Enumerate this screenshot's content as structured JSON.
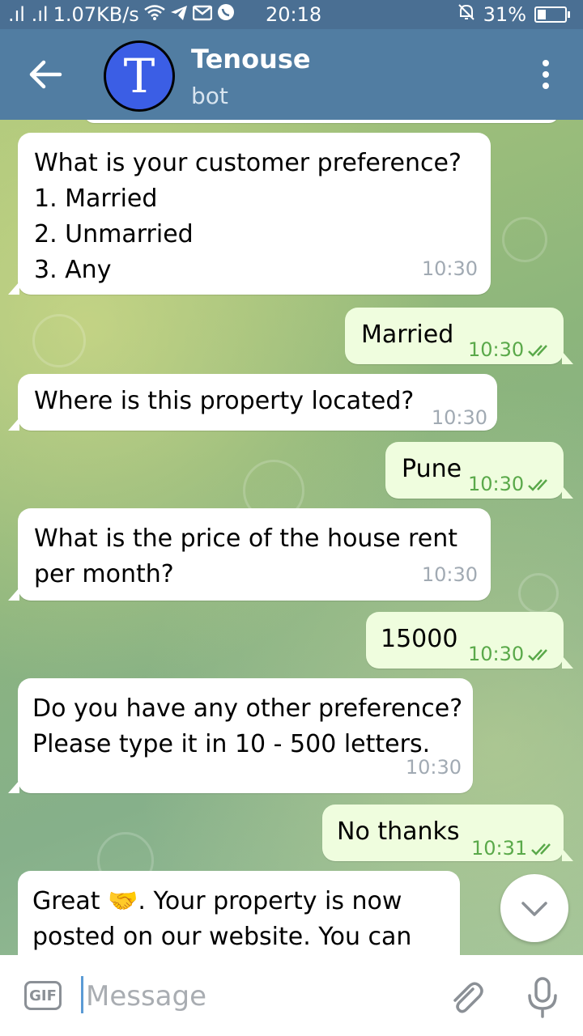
{
  "status_bar": {
    "signal_text": ".ıl .ıl",
    "network_speed": "1.07KB/s",
    "time": "20:18",
    "battery": "31%",
    "battery_level": 0.31
  },
  "header": {
    "avatar_letter": "T",
    "title": "Tenouse",
    "subtitle": "bot"
  },
  "messages": [
    {
      "dir": "in",
      "lines": [
        "What is your customer preference?",
        "1. Married",
        "2. Unmarried",
        "3. Any"
      ],
      "time": "10:30"
    },
    {
      "dir": "out",
      "lines": [
        "Married"
      ],
      "time": "10:30"
    },
    {
      "dir": "in",
      "lines": [
        "Where is this property located?"
      ],
      "time": "10:30"
    },
    {
      "dir": "out",
      "lines": [
        "Pune"
      ],
      "time": "10:30"
    },
    {
      "dir": "in",
      "lines": [
        "What is the price of the house rent",
        "per month?"
      ],
      "time": "10:30"
    },
    {
      "dir": "out",
      "lines": [
        "15000"
      ],
      "time": "10:30"
    },
    {
      "dir": "in",
      "lines": [
        "Do you have any other preference?",
        "Please type it in 10 - 500 letters."
      ],
      "time": "10:30"
    },
    {
      "dir": "out",
      "lines": [
        "No thanks"
      ],
      "time": "10:31"
    },
    {
      "dir": "in",
      "lines": [
        "Great 🤝. Your property is now",
        "posted on our website. You can"
      ],
      "time": ""
    }
  ],
  "input": {
    "gif_label": "GIF",
    "placeholder": "Message"
  },
  "icons": [
    "back-arrow-icon",
    "more-vert-icon",
    "double-check-icon",
    "chevron-down-icon",
    "gif-icon",
    "paperclip-icon",
    "microphone-icon"
  ],
  "colors": {
    "header": "#517da2",
    "status_bar": "#4a6f93",
    "incoming_bubble": "#ffffff",
    "outgoing_bubble": "#effdde",
    "outgoing_time": "#5aa94a",
    "avatar": "#3b5ee5"
  }
}
